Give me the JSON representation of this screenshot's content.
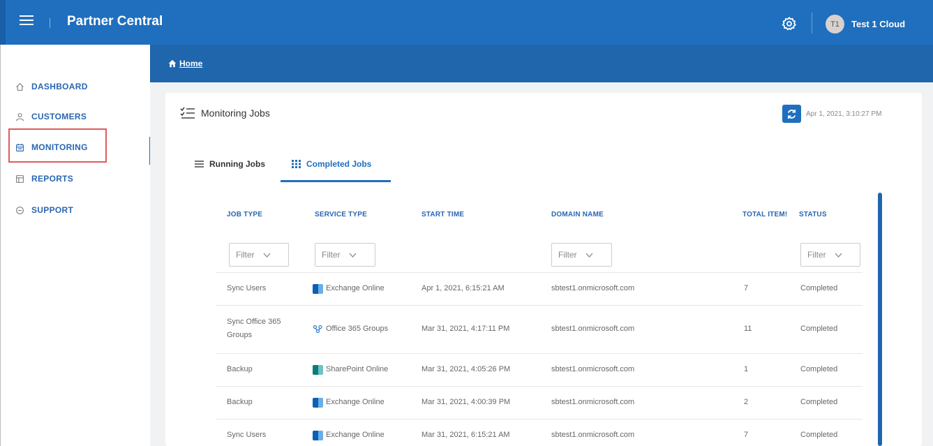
{
  "header": {
    "app_title": "Partner Central",
    "avatar_initials": "T1",
    "user_name": "Test 1 Cloud"
  },
  "sidebar": {
    "items": [
      {
        "label": "DASHBOARD",
        "icon": "home-icon"
      },
      {
        "label": "CUSTOMERS",
        "icon": "person-icon"
      },
      {
        "label": "MONITORING",
        "icon": "calendar-icon"
      },
      {
        "label": "REPORTS",
        "icon": "report-icon"
      },
      {
        "label": "SUPPORT",
        "icon": "chat-icon"
      }
    ]
  },
  "breadcrumb": {
    "home": "Home"
  },
  "card": {
    "title": "Monitoring Jobs",
    "timestamp": "Apr 1, 2021, 3:10:27 PM"
  },
  "tabs": [
    {
      "label": "Running Jobs",
      "active": false
    },
    {
      "label": "Completed Jobs",
      "active": true
    }
  ],
  "table": {
    "columns": [
      "JOB TYPE",
      "SERVICE TYPE",
      "START TIME",
      "DOMAIN NAME",
      "TOTAL ITEM!",
      "STATUS"
    ],
    "filter_placeholder": "Filter",
    "rows": [
      {
        "job_type": "Sync Users",
        "service": "Exchange Online",
        "service_icon": "exchange-icon",
        "start_time": "Apr 1, 2021, 6:15:21 AM",
        "domain": "sbtest1.onmicrosoft.com",
        "total": "7",
        "status": "Completed"
      },
      {
        "job_type": "Sync Office 365 Groups",
        "service": "Office 365 Groups",
        "service_icon": "groups-icon",
        "start_time": "Mar 31, 2021, 4:17:11 PM",
        "domain": "sbtest1.onmicrosoft.com",
        "total": "11",
        "status": "Completed"
      },
      {
        "job_type": "Backup",
        "service": "SharePoint Online",
        "service_icon": "sharepoint-icon",
        "start_time": "Mar 31, 2021, 4:05:26 PM",
        "domain": "sbtest1.onmicrosoft.com",
        "total": "1",
        "status": "Completed"
      },
      {
        "job_type": "Backup",
        "service": "Exchange Online",
        "service_icon": "exchange-icon",
        "start_time": "Mar 31, 2021, 4:00:39 PM",
        "domain": "sbtest1.onmicrosoft.com",
        "total": "2",
        "status": "Completed"
      },
      {
        "job_type": "Sync Users",
        "service": "Exchange Online",
        "service_icon": "exchange-icon",
        "start_time": "Mar 31, 2021, 6:15:21 AM",
        "domain": "sbtest1.onmicrosoft.com",
        "total": "7",
        "status": "Completed"
      }
    ]
  },
  "colors": {
    "brand": "#1f6fbe",
    "breadcrumb": "#1f66ad",
    "highlight": "#e05a5a"
  }
}
